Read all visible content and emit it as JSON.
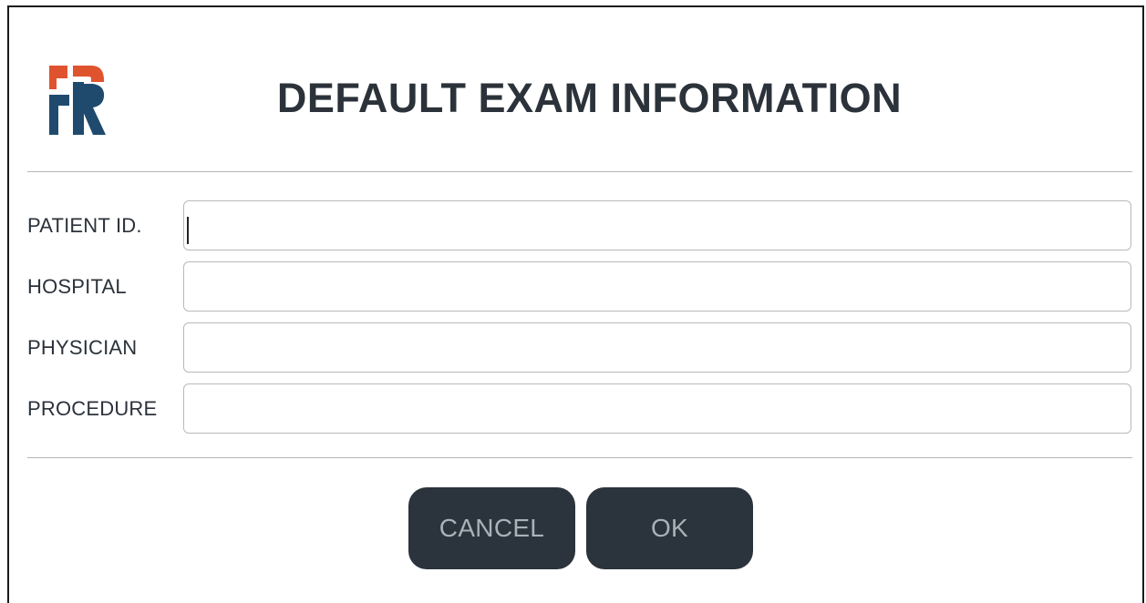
{
  "dialog": {
    "title": "DEFAULT EXAM INFORMATION",
    "logo_icon": "fr-logo-icon",
    "colors": {
      "logo_red": "#e0532f",
      "logo_navy": "#1f4a6e",
      "text": "#2b323a",
      "button_bg": "#2b333c",
      "button_text": "#a9b1b9"
    }
  },
  "fields": [
    {
      "label": "PATIENT ID.",
      "value": "",
      "placeholder": ""
    },
    {
      "label": "HOSPITAL",
      "value": "",
      "placeholder": ""
    },
    {
      "label": "PHYSICIAN",
      "value": "",
      "placeholder": ""
    },
    {
      "label": "PROCEDURE",
      "value": "",
      "placeholder": ""
    }
  ],
  "buttons": {
    "cancel_label": "CANCEL",
    "ok_label": "OK"
  }
}
